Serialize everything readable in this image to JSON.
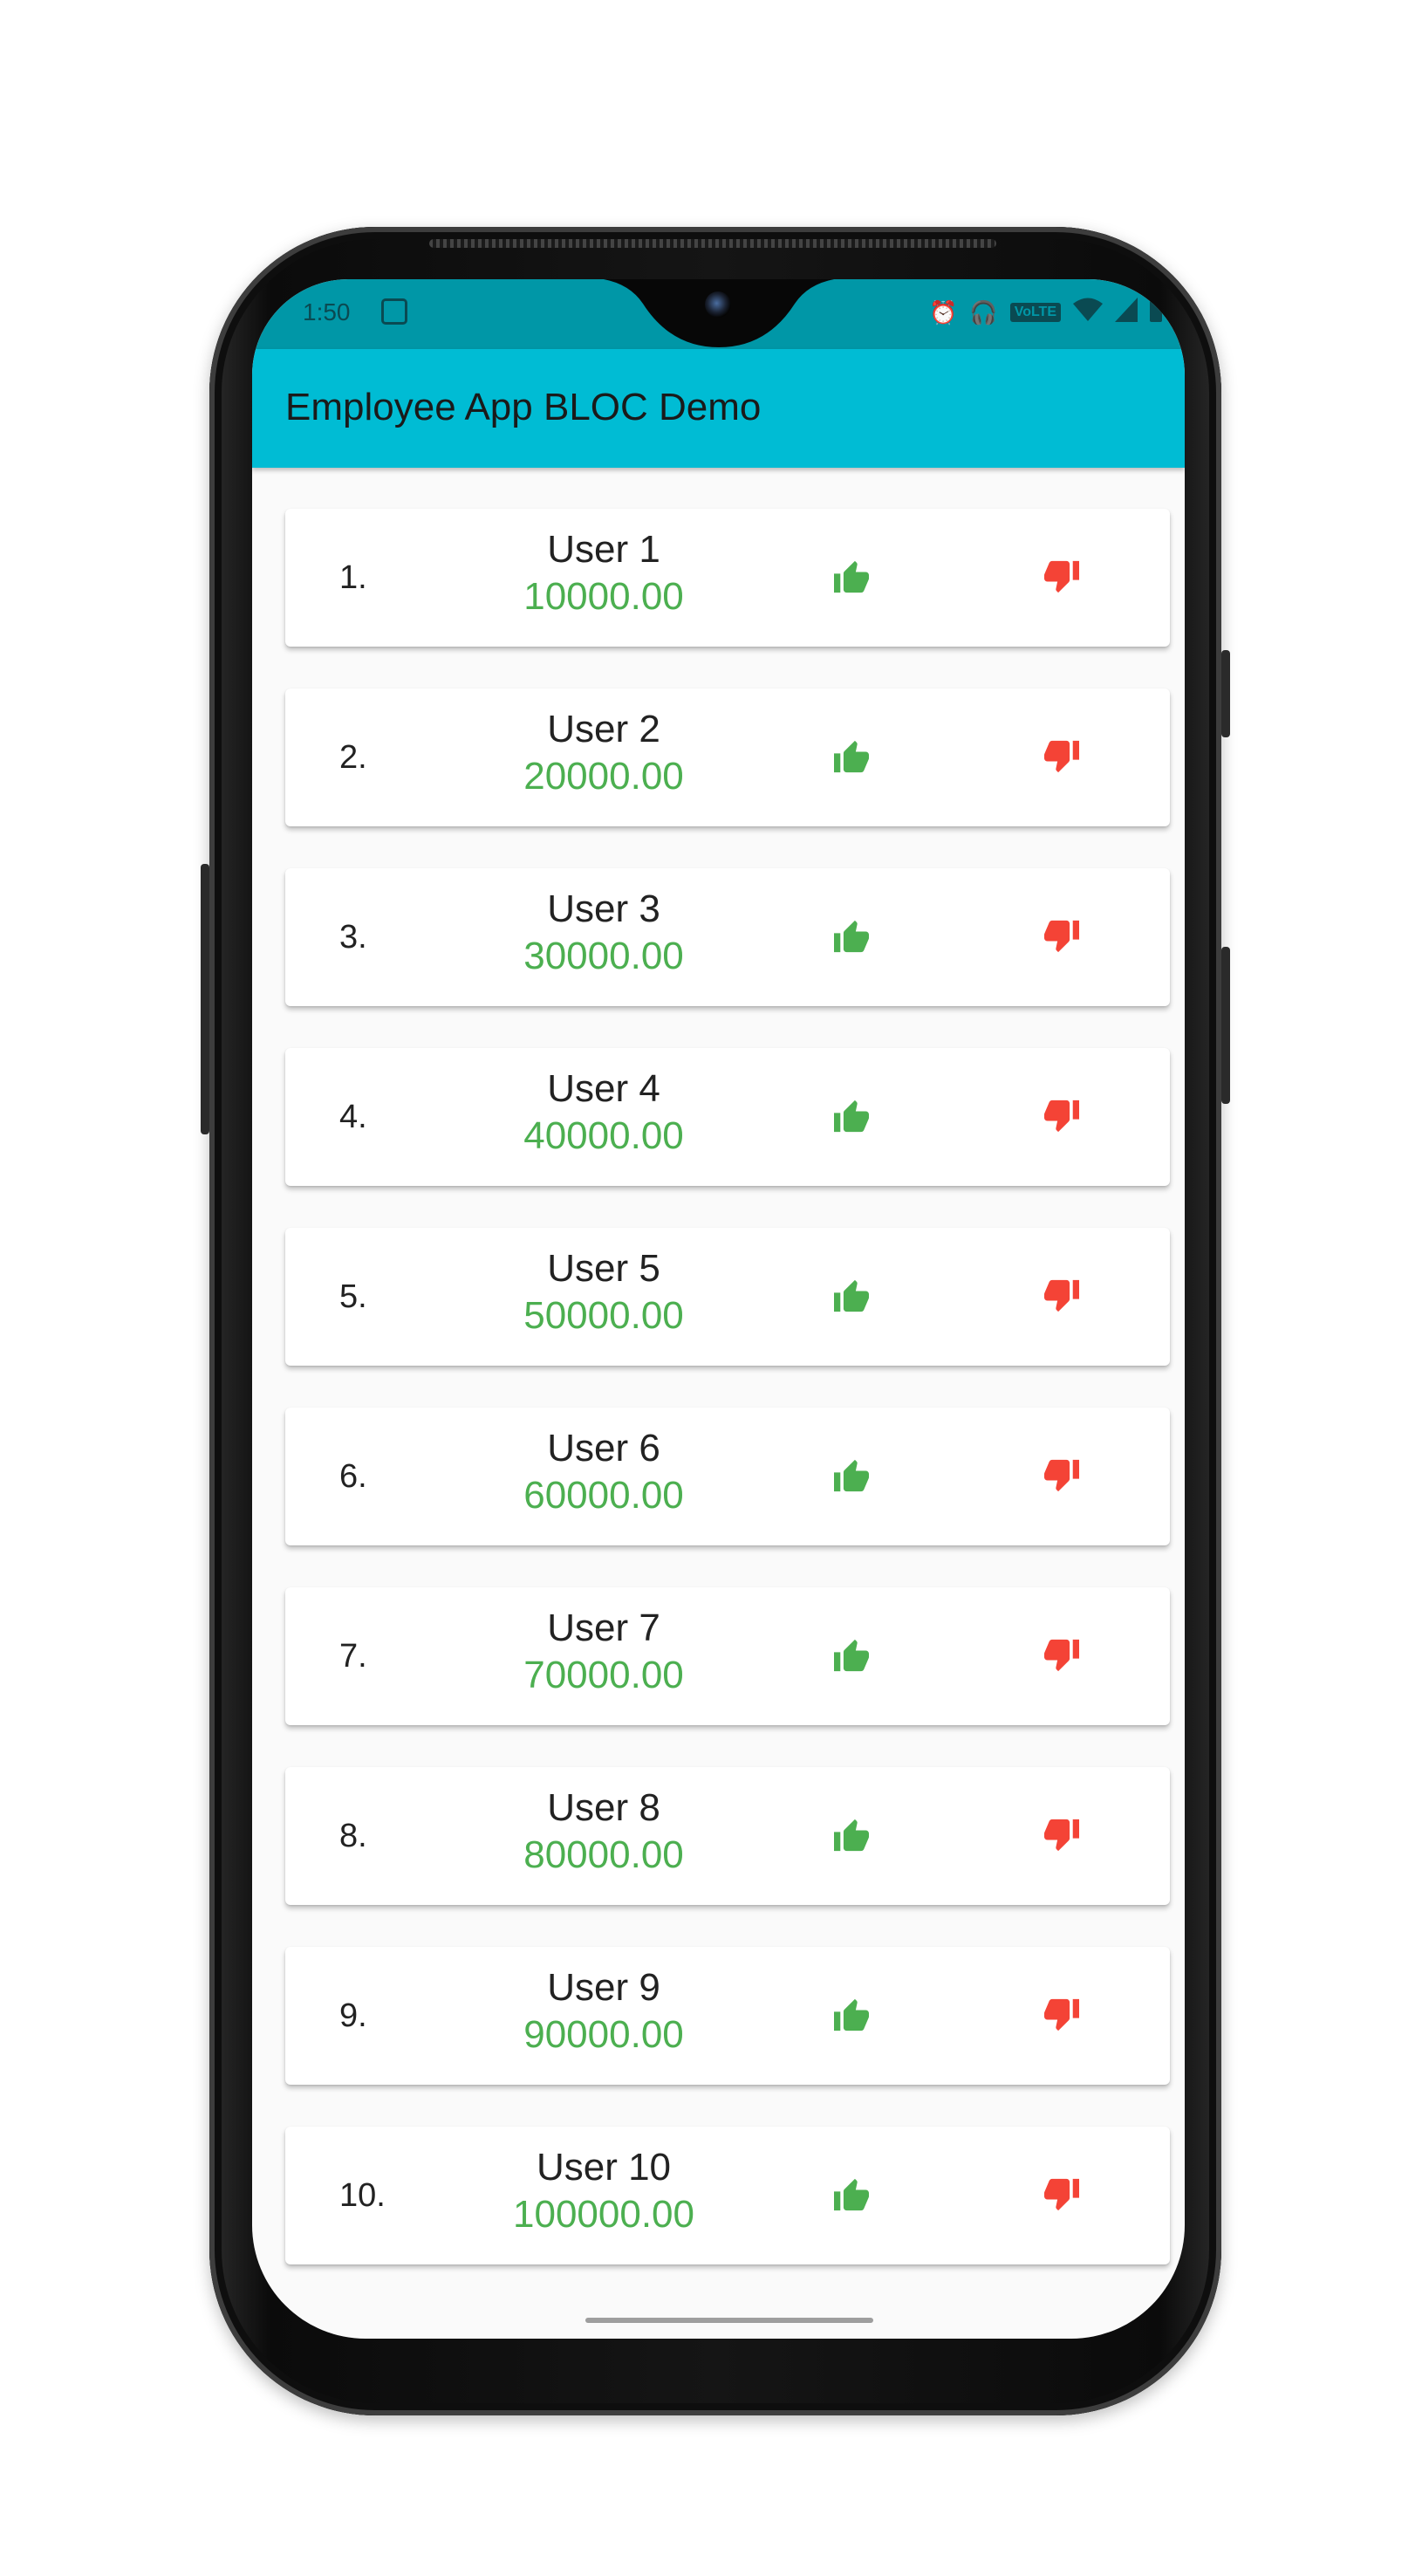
{
  "status_bar": {
    "time": "1:50",
    "volte": "VoLTE",
    "icons": [
      "app-notification-icon",
      "alarm-icon",
      "headphones-icon",
      "volte-icon",
      "wifi-icon",
      "signal-icon",
      "battery-icon"
    ]
  },
  "app_bar": {
    "title": "Employee App BLOC Demo",
    "color": "#00bcd4"
  },
  "employees": [
    {
      "index": "1.",
      "name": "User 1",
      "salary": "10000.00"
    },
    {
      "index": "2.",
      "name": "User 2",
      "salary": "20000.00"
    },
    {
      "index": "3.",
      "name": "User 3",
      "salary": "30000.00"
    },
    {
      "index": "4.",
      "name": "User 4",
      "salary": "40000.00"
    },
    {
      "index": "5.",
      "name": "User 5",
      "salary": "50000.00"
    },
    {
      "index": "6.",
      "name": "User 6",
      "salary": "60000.00"
    },
    {
      "index": "7.",
      "name": "User 7",
      "salary": "70000.00"
    },
    {
      "index": "8.",
      "name": "User 8",
      "salary": "80000.00"
    },
    {
      "index": "9.",
      "name": "User 9",
      "salary": "90000.00"
    },
    {
      "index": "10.",
      "name": "User 10",
      "salary": "100000.00"
    }
  ],
  "colors": {
    "salary": "#4caf50",
    "thumb_up": "#4caf50",
    "thumb_down": "#f44336"
  }
}
